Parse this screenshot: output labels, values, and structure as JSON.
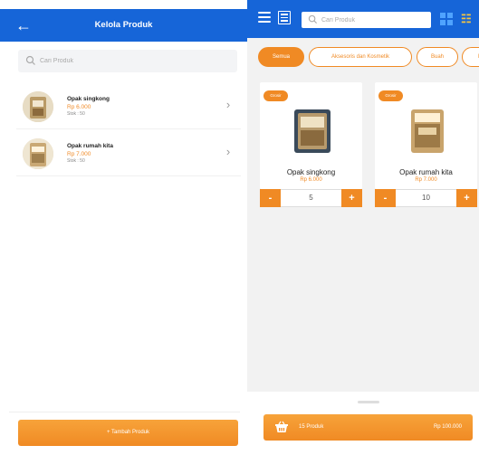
{
  "left": {
    "title": "Kelola Produk",
    "search_placeholder": "Cari Produk",
    "products": [
      {
        "name": "Opak singkong",
        "price": "Rp 6.000",
        "stock": "Stok : 50"
      },
      {
        "name": "Opak rumah kita",
        "price": "Rp 7.000",
        "stock": "Stok : 50"
      }
    ],
    "add_button": "+ Tambah Produk"
  },
  "right": {
    "search_placeholder": "Cari Produk",
    "categories": [
      "Semua",
      "Aksesoris dan Kosmetik",
      "Buah",
      "B"
    ],
    "active_category": "Semua",
    "cards": [
      {
        "badge": "Grosir",
        "name": "Opak singkong",
        "price": "Rp 6.000",
        "qty": "5"
      },
      {
        "badge": "Grosir",
        "name": "Opak rumah kita",
        "price": "Rp 7.000",
        "qty": "10"
      }
    ],
    "cart": {
      "count_label": "15 Produk",
      "total": "Rp 100.000"
    }
  },
  "colors": {
    "primary_blue": "#1665d8",
    "accent_orange": "#f08a24"
  },
  "icons": [
    "back-arrow-icon",
    "search-icon",
    "chevron-right-icon",
    "hamburger-menu-icon",
    "list-view-icon",
    "grid-view-icon",
    "barcode-scan-icon",
    "basket-icon"
  ]
}
